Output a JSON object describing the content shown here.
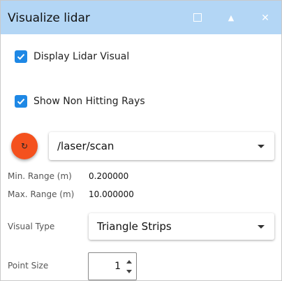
{
  "window": {
    "title": "Visualize lidar"
  },
  "options": {
    "display_lidar": {
      "label": "Display Lidar Visual",
      "checked": true
    },
    "non_hitting_rays": {
      "label": "Show Non Hitting Rays",
      "checked": true
    }
  },
  "topic": {
    "selected": "/laser/scan"
  },
  "range": {
    "min_label": "Min. Range (m)",
    "min_value": "0.200000",
    "max_label": "Max. Range (m)",
    "max_value": "10.000000"
  },
  "visual_type": {
    "label": "Visual Type",
    "selected": "Triangle Strips"
  },
  "point_size": {
    "label": "Point Size",
    "value": "1"
  },
  "colors": {
    "titlebar": "#b3d6f5",
    "checkbox": "#1e88e5",
    "refresh_button": "#f4511e"
  }
}
